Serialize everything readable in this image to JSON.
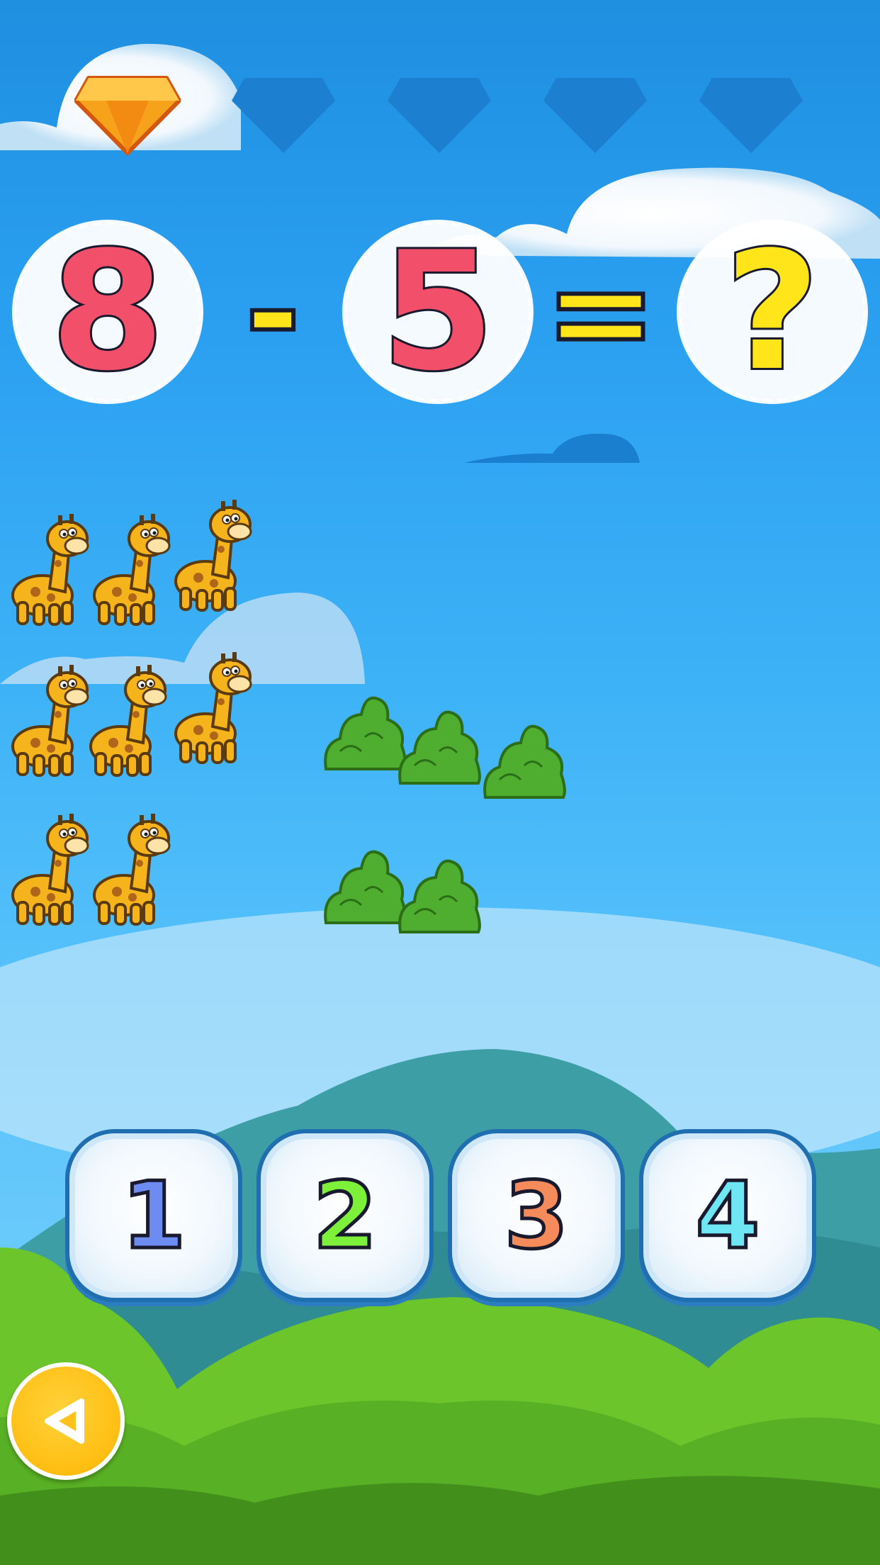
{
  "progress": {
    "total_gems": 5,
    "earned_gems": 1,
    "earned_color": "#f7a21b",
    "empty_color": "#1c7fcf"
  },
  "equation": {
    "left_operand": "8",
    "operator": "-",
    "right_operand": "5",
    "equals": "=",
    "unknown": "?",
    "operand_color": "#f2506a",
    "symbol_color": "#ffe51a"
  },
  "counters": {
    "giraffes_total": 8,
    "bushes_total": 5
  },
  "answers": {
    "options": [
      {
        "label": "1",
        "color": "#6d8cf2"
      },
      {
        "label": "2",
        "color": "#7df03a"
      },
      {
        "label": "3",
        "color": "#f58b5a"
      },
      {
        "label": "4",
        "color": "#6ee6f3"
      }
    ]
  },
  "navigation": {
    "back_icon": "back-arrow-icon"
  }
}
